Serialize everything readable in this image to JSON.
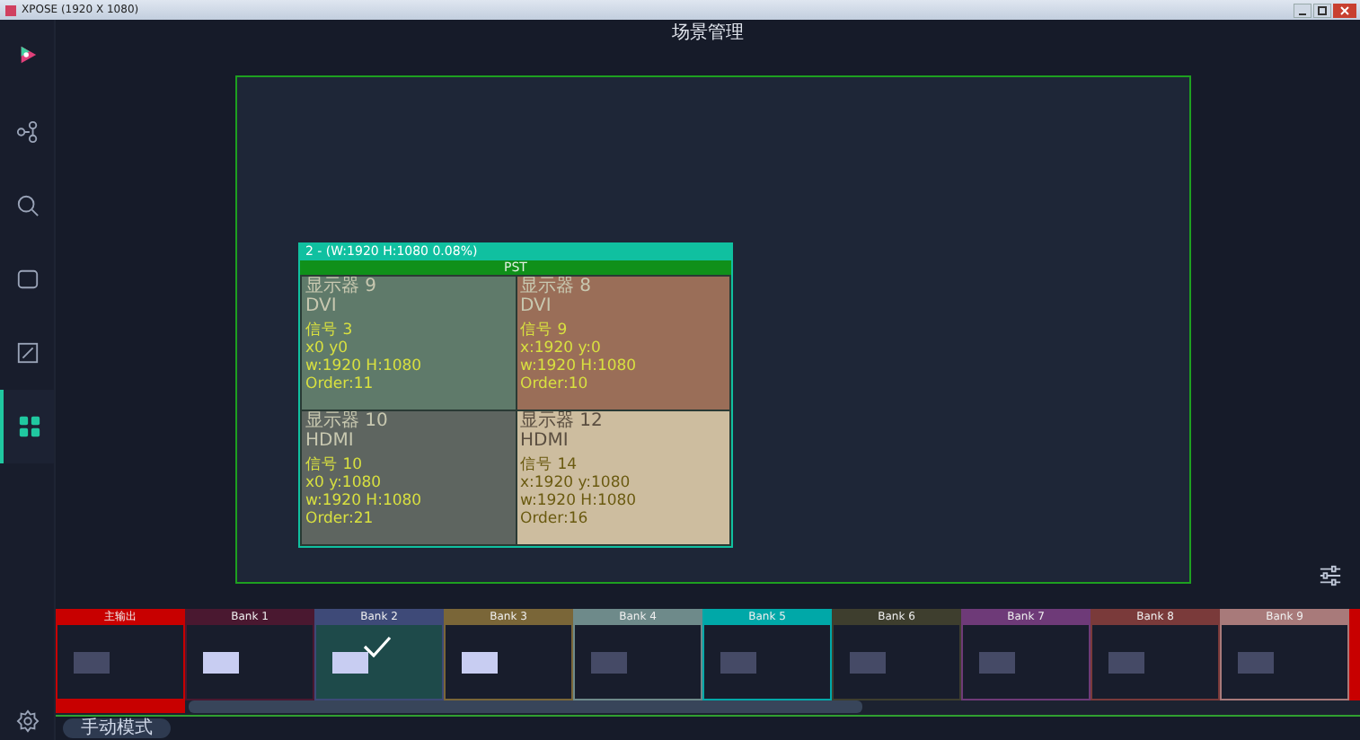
{
  "window": {
    "title": "XPOSE (1920 X 1080)"
  },
  "header": {
    "title": "场景管理"
  },
  "sidebar": {
    "items": [
      {
        "selected": false
      },
      {
        "selected": false
      },
      {
        "selected": false
      },
      {
        "selected": false
      },
      {
        "selected": true
      }
    ]
  },
  "canvas": {
    "windows": [
      {
        "title": "2 - (W:1920 H:1080 0.08%)",
        "badge": "PST",
        "cells": [
          {
            "color": "#5f7a6a",
            "lines": [
              "显示器 9",
              "DVI",
              "信号 3",
              "x0 y0",
              "w:1920 H:1080",
              "Order:11"
            ]
          },
          {
            "color": "#9a6e58",
            "lines": [
              "显示器 8",
              "DVI",
              "信号 9",
              "x:1920 y:0",
              "w:1920 H:1080",
              "Order:10"
            ]
          },
          {
            "color": "#5e6560",
            "lines": [
              "显示器 10",
              "HDMI",
              "信号 10",
              "x0 y:1080",
              "w:1920 H:1080",
              "Order:21"
            ]
          },
          {
            "color": "#cdbd9f",
            "lines": [
              "显示器 12",
              "HDMI",
              "信号 14",
              "x:1920 y:1080",
              "w:1920 H:1080",
              "Order:16"
            ]
          }
        ]
      }
    ]
  },
  "banks": [
    {
      "label": "主输出",
      "color": "#c80000",
      "selected": false,
      "lit": false,
      "kind": "main"
    },
    {
      "label": "Bank 1",
      "color": "#4a1830",
      "selected": false,
      "lit": true,
      "kind": "bank"
    },
    {
      "label": "Bank 2",
      "color": "#3e4a78",
      "selected": true,
      "lit": true,
      "kind": "bank"
    },
    {
      "label": "Bank 3",
      "color": "#7a6638",
      "selected": false,
      "lit": true,
      "kind": "bank"
    },
    {
      "label": "Bank 4",
      "color": "#6e8a8a",
      "selected": false,
      "lit": false,
      "kind": "bank"
    },
    {
      "label": "Bank 5",
      "color": "#00a8a8",
      "selected": false,
      "lit": false,
      "kind": "bank"
    },
    {
      "label": "Bank 6",
      "color": "#3e3e2e",
      "selected": false,
      "lit": false,
      "kind": "bank"
    },
    {
      "label": "Bank 7",
      "color": "#6e3a78",
      "selected": false,
      "lit": false,
      "kind": "bank"
    },
    {
      "label": "Bank 8",
      "color": "#7a3a3a",
      "selected": false,
      "lit": false,
      "kind": "bank"
    },
    {
      "label": "Bank 9",
      "color": "#a87a7a",
      "selected": false,
      "lit": false,
      "kind": "bank"
    },
    {
      "color": "#c80000",
      "kind": "cut"
    }
  ],
  "footer": {
    "mode": "手动模式"
  }
}
